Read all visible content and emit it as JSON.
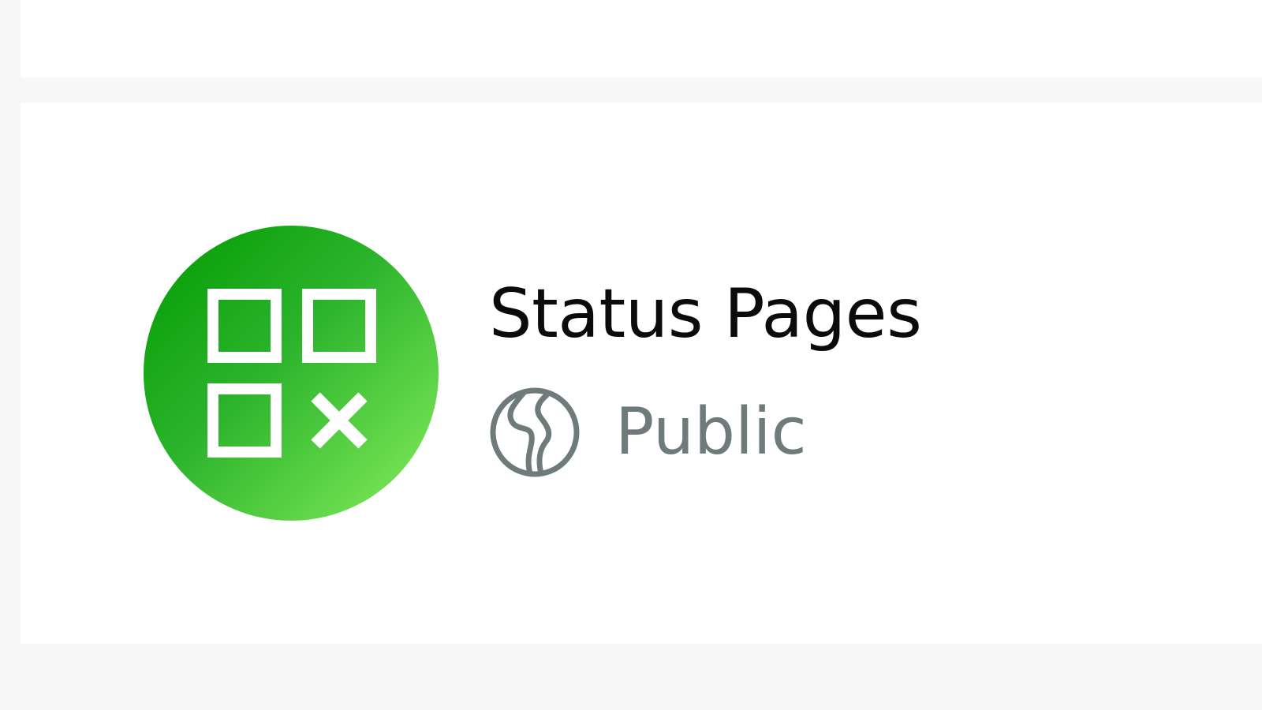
{
  "app": {
    "title": "Status Pages",
    "visibility": "Public",
    "icon": "status-pages-icon",
    "visibility_icon": "globe-icon",
    "colors": {
      "icon_gradient_start": "#009a00",
      "icon_gradient_end": "#86ee5c",
      "title_text": "#0b0b0b",
      "visibility_text": "#6f7a7a"
    }
  }
}
